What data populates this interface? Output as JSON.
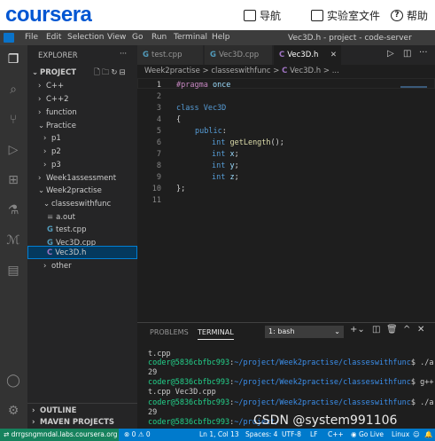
{
  "coursera": {
    "logo": "coursera",
    "nav": [
      {
        "label": "导航",
        "icon": "navigation-icon"
      },
      {
        "label": "实验室文件",
        "icon": "lab-files-icon"
      },
      {
        "label": "帮助",
        "icon": "help-icon"
      }
    ]
  },
  "titlebar": {
    "menus": [
      "File",
      "Edit",
      "Selection",
      "View",
      "Go",
      "Run",
      "Terminal",
      "Help"
    ],
    "window_title": "Vec3D.h - project - code-server"
  },
  "explorer": {
    "header": "EXPLORER",
    "project": "PROJECT",
    "items": [
      "C++",
      "C++2",
      "function",
      "Practice",
      "p1",
      "p2",
      "p3",
      "Week1assessment",
      "Week2practise",
      "classeswithfunc",
      "a.out",
      "test.cpp",
      "Vec3D.cpp",
      "Vec3D.h",
      "other"
    ],
    "outline": "OUTLINE",
    "maven": "MAVEN PROJECTS"
  },
  "tabs": [
    {
      "label": "test.cpp",
      "type": "C++"
    },
    {
      "label": "Vec3D.cpp",
      "type": "C++"
    },
    {
      "label": "Vec3D.h",
      "type": "C",
      "active": true
    }
  ],
  "breadcrumb": {
    "folder1": "Week2practise",
    "sep": ">",
    "folder2": "classeswithfunc",
    "file": "Vec3D.h",
    "file_icon": "C"
  },
  "editor": {
    "line_numbers": [
      "1",
      "2",
      "3",
      "4",
      "5",
      "6",
      "7",
      "8",
      "9",
      "10",
      "11"
    ],
    "lines": [
      {
        "a": "#pragma",
        "b": " once"
      },
      {
        "a": "",
        "b": ""
      },
      {
        "a": "class",
        "b": " Vec3D"
      },
      {
        "a": "",
        "b": "{"
      },
      {
        "a": "public",
        "b": ":"
      },
      {
        "a": "int",
        "b": " getLength",
        "c": "();"
      },
      {
        "a": "int",
        "b": " x",
        "c": ";"
      },
      {
        "a": "int",
        "b": " y",
        "c": ";"
      },
      {
        "a": "int",
        "b": " z",
        "c": ";"
      },
      {
        "a": "",
        "b": "};"
      },
      {
        "a": "",
        "b": ""
      }
    ]
  },
  "panel": {
    "tabs": [
      "PROBLEMS",
      "TERMINAL"
    ],
    "terminal_select": "1: bash",
    "terminal_lines": [
      {
        "plain": "t.cpp"
      },
      {
        "user": "coder@5836cbfbc993",
        "path": "~/project/Week2practise/classeswithfunc",
        "cmd": "$ ./a.out"
      },
      {
        "plain": "29"
      },
      {
        "user": "coder@5836cbfbc993",
        "path": "~/project/Week2practise/classeswithfunc",
        "cmd": "$ g++ tes"
      },
      {
        "plain": "t.cpp Vec3D.cpp"
      },
      {
        "user": "coder@5836cbfbc993",
        "path": "~/project/Week2practise/classeswithfunc",
        "cmd": "$ ./a.out"
      },
      {
        "plain": "29"
      },
      {
        "user": "coder@5836cbfbc993",
        "path": "~/project/",
        "cmd": ""
      }
    ]
  },
  "statusbar": {
    "remote": "drrgsngmndal.labs.coursera.org",
    "problems": "⊗ 0 ⚠ 0",
    "position": "Ln 1, Col 13",
    "spaces": "Spaces: 4",
    "encoding": "UTF-8",
    "eol": "LF",
    "language": "C++",
    "golive": "Go Live",
    "os": "Linux"
  },
  "watermark": "CSDN @system991106",
  "colors": {
    "status_blue": "#007acc",
    "remote_green": "#16825d",
    "coursera_blue": "#0056d2"
  }
}
